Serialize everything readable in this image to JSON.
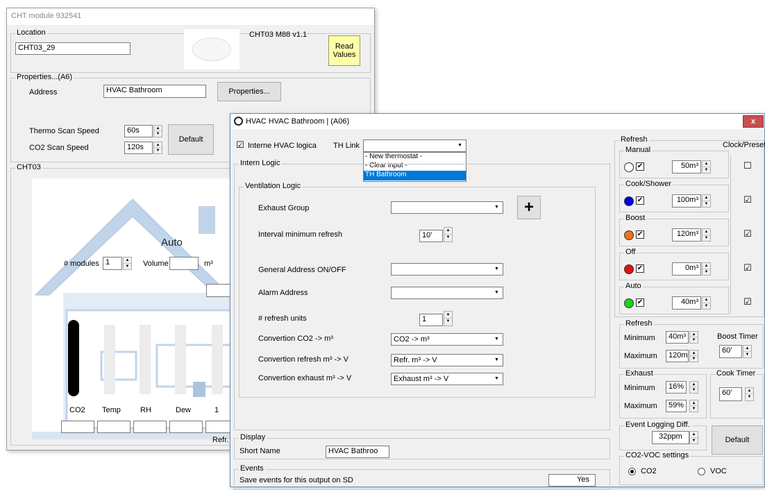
{
  "module_window": {
    "title": "CHT module 932541",
    "location_group": "Location",
    "location_value": "CHT03_29",
    "firmware": "CHT03 M88 v1.1",
    "read_values": "Read Values",
    "properties_group": "Properties...(A6)",
    "address_label": "Address",
    "address_value": "HVAC Bathroom",
    "properties_button": "Properties...",
    "thermo_scan_label": "Thermo Scan Speed",
    "thermo_scan_value": "60s",
    "co2_scan_label": "CO2 Scan Speed",
    "co2_scan_value": "120s",
    "default_button": "Default",
    "cht_group": "CHT03",
    "mode_label": "Auto",
    "modules_label": "# modules",
    "modules_value": "1",
    "volume_label": "Volume",
    "volume_unit": "m³",
    "bars": {
      "co2": "CO2",
      "temp": "Temp",
      "rh": "RH",
      "dew": "Dew",
      "one": "1"
    },
    "refr_label": "Refr."
  },
  "hvac_window": {
    "title": "HVAC HVAC Bathroom |  (A06)",
    "interne_label": "Interne HVAC logica",
    "interne_checked": "☑",
    "th_link_label": "TH Link",
    "th_link_options": [
      "- New thermostat -",
      "- Clear input -",
      "TH Bathroom"
    ],
    "intern_logic_group": "Intern Logic",
    "ventilation_group": "Ventilation Logic",
    "exhaust_group_label": "Exhaust Group",
    "plus_button": "+",
    "interval_label": "Interval minimum refresh",
    "interval_value": "10'",
    "general_address_label": "General Address ON/OFF",
    "alarm_address_label": "Alarm Address",
    "refresh_units_label": "# refresh units",
    "refresh_units_value": "1",
    "conv_co2_label": "Convertion CO2 -> m³",
    "conv_co2_value": "CO2 -> m³",
    "conv_refresh_label": "Convertion refresh m³ -> V",
    "conv_refresh_value": "Refr. m³ -> V",
    "conv_exhaust_label": "Convertion exhaust m³ -> V",
    "conv_exhaust_value": "Exhaust m³ -> V",
    "display_group": "Display",
    "short_name_label": "Short Name",
    "short_name_value": "HVAC Bathroo",
    "events_group": "Events",
    "save_events_label": "Save events for this output on SD",
    "save_events_value": "Yes",
    "close_icon": "x"
  },
  "refresh_panel": {
    "group": "Refresh",
    "clock_preset": "Clock/Preset",
    "modes": [
      {
        "name": "Manual",
        "value": "50m³",
        "color": "#ffffff",
        "preset": "☐"
      },
      {
        "name": "Cook/Shower",
        "value": "100m³",
        "color": "#0000e0",
        "preset": "☑"
      },
      {
        "name": "Boost",
        "value": "120m³",
        "color": "#f07020",
        "preset": "☑"
      },
      {
        "name": "Off",
        "value": "0m³",
        "color": "#e01010",
        "preset": "☑"
      },
      {
        "name": "Auto",
        "value": "40m³",
        "color": "#20d020",
        "preset": "☑"
      }
    ],
    "refresh2_group": "Refresh",
    "minimum_label": "Minimum",
    "minimum_value": "40m³",
    "maximum_label": "Maximum",
    "maximum_value": "120m³",
    "boost_timer_label": "Boost Timer",
    "boost_timer_value": "60'",
    "exhaust_group": "Exhaust",
    "ex_min_label": "Minimum",
    "ex_min_value": "16%",
    "ex_max_label": "Maximum",
    "ex_max_value": "59%",
    "cook_timer_label": "Cook Timer",
    "cook_timer_value": "60'",
    "event_logging_label": "Event Logging Diff.",
    "event_logging_value": "32ppm",
    "default_button": "Default",
    "co2voc_group": "CO2-VOC settings",
    "co2_label": "CO2",
    "voc_label": "VOC"
  }
}
